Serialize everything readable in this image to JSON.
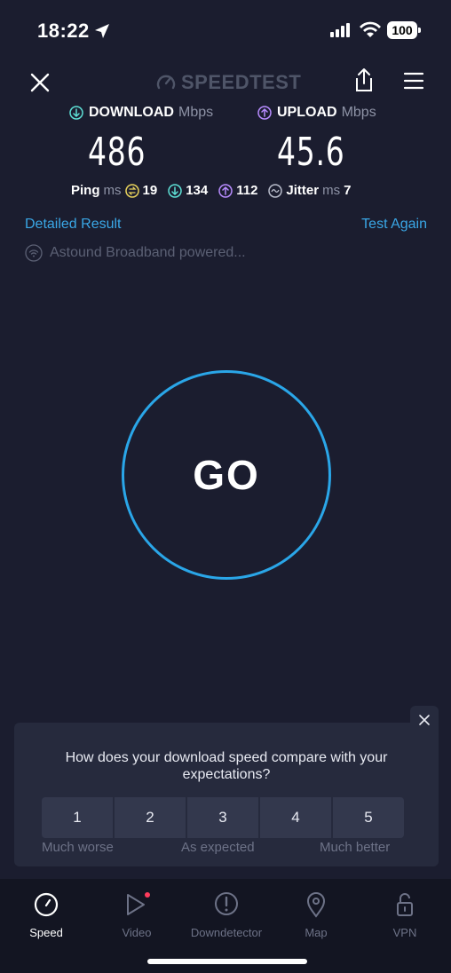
{
  "status": {
    "time": "18:22",
    "battery": "100"
  },
  "header": {
    "logo_text": "SPEEDTEST"
  },
  "results": {
    "download": {
      "label": "DOWNLOAD",
      "unit": "Mbps",
      "value": "486"
    },
    "upload": {
      "label": "UPLOAD",
      "unit": "Mbps",
      "value": "45.6"
    },
    "ping": {
      "label": "Ping",
      "unit": "ms",
      "idle": "19",
      "download": "134",
      "upload": "112"
    },
    "jitter": {
      "label": "Jitter",
      "unit": "ms",
      "value": "7"
    }
  },
  "links": {
    "detailed": "Detailed Result",
    "again": "Test Again"
  },
  "isp": "Astound Broadband powered...",
  "go": "GO",
  "survey": {
    "question": "How does your download speed compare with your expectations?",
    "ratings": [
      "1",
      "2",
      "3",
      "4",
      "5"
    ],
    "scale": {
      "left": "Much worse",
      "mid": "As expected",
      "right": "Much better"
    }
  },
  "nav": {
    "speed": "Speed",
    "video": "Video",
    "downdetector": "Downdetector",
    "map": "Map",
    "vpn": "VPN"
  },
  "colors": {
    "background": "#1b1d2f",
    "accent": "#2aa6e8",
    "download": "#5ee0d6",
    "upload": "#b88cff",
    "ping_idle": "#e8d25c"
  }
}
